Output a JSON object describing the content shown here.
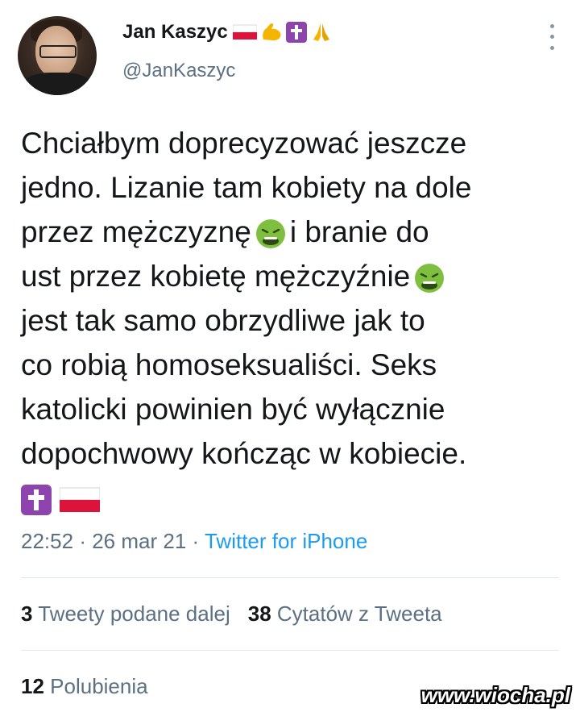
{
  "tweet": {
    "author": {
      "display_name": "Jan Kaszyc",
      "name_emojis": [
        "flag-poland-icon",
        "flexed-biceps-icon",
        "latin-cross-icon",
        "folded-hands-icon"
      ],
      "handle": "@JanKaszyc"
    },
    "text_lines": [
      "Chciałbym doprecyzować jeszcze",
      "jedno. Lizanie tam kobiety na dole",
      "przez mężczyznę",
      "i branie do",
      "ust przez kobietę mężczyźnie",
      "jest tak samo obrzydliwe jak to",
      "co robią homoseksualiści. Seks",
      "katolicki powinien być wyłącznie",
      "dopochwowy kończąc w kobiecie."
    ],
    "text_emojis": [
      "nauseated-face-icon",
      "nauseated-face-icon",
      "latin-cross-icon",
      "flag-poland-icon"
    ],
    "time": "22:52",
    "separator": "·",
    "date": "26 mar 21",
    "source": "Twitter for iPhone"
  },
  "stats": {
    "retweets_count": "3",
    "retweets_label": "Tweety podane dalej",
    "quotes_count": "38",
    "quotes_label": "Cytatów z Tweeta",
    "likes_count": "12",
    "likes_label": "Polubienia"
  },
  "watermark": "www.wiocha.pl",
  "colors": {
    "text": "#14171a",
    "secondary": "#5b7083",
    "link": "#1d9bf0",
    "divider": "#e1e8ed"
  }
}
